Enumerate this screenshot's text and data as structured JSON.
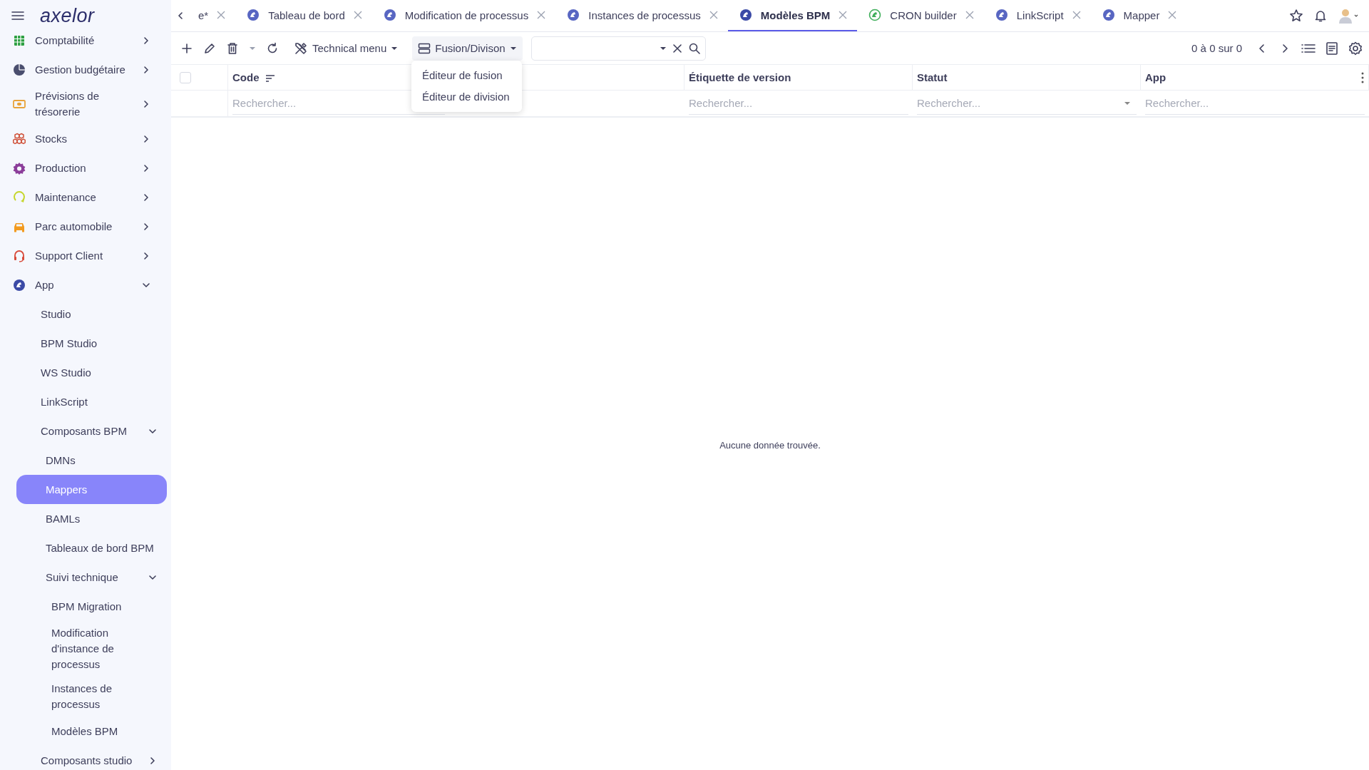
{
  "app": {
    "logo": "axelor"
  },
  "sidebar": {
    "items": [
      {
        "label": "Comptabilité",
        "color": "#2ea043",
        "expanded": false
      },
      {
        "label": "Gestion budgétaire",
        "color": "#4a4e6e",
        "expanded": false
      },
      {
        "label": "Prévisions de trésorerie",
        "color": "#e8a33a",
        "expanded": false
      },
      {
        "label": "Stocks",
        "color": "#d0523a",
        "expanded": false
      },
      {
        "label": "Production",
        "color": "#8b3d9a",
        "expanded": false
      },
      {
        "label": "Maintenance",
        "color": "#c5d62a",
        "expanded": false
      },
      {
        "label": "Parc automobile",
        "color": "#f29a1f",
        "expanded": false
      },
      {
        "label": "Support Client",
        "color": "#d84a3a",
        "expanded": false
      },
      {
        "label": "App",
        "color": "#3b4aa6",
        "expanded": true,
        "children": [
          {
            "label": "Studio",
            "selected": false
          },
          {
            "label": "BPM Studio",
            "selected": false
          },
          {
            "label": "WS Studio",
            "selected": false
          },
          {
            "label": "LinkScript",
            "selected": false
          },
          {
            "label": "Composants BPM",
            "expanded": true,
            "children": [
              {
                "label": "DMNs",
                "selected": false
              },
              {
                "label": "Mappers",
                "selected": true
              },
              {
                "label": "BAMLs",
                "selected": false
              },
              {
                "label": "Tableaux de bord BPM",
                "selected": false
              },
              {
                "label": "Suivi technique",
                "expanded": true,
                "children": [
                  {
                    "label": "BPM Migration",
                    "selected": false
                  },
                  {
                    "label": "Modification d'instance de processus",
                    "selected": false
                  },
                  {
                    "label": "Instances de processus",
                    "selected": false
                  },
                  {
                    "label": "Modèles BPM",
                    "selected": false
                  }
                ]
              }
            ]
          },
          {
            "label": "Composants studio",
            "expanded": false
          }
        ]
      }
    ]
  },
  "tabs": [
    {
      "label": "e*",
      "selected": false,
      "kind": "plain"
    },
    {
      "label": "Tableau de bord",
      "selected": false,
      "kind": "bpm"
    },
    {
      "label": "Modification de processus",
      "selected": false,
      "kind": "bpm"
    },
    {
      "label": "Instances de processus",
      "selected": false,
      "kind": "bpm"
    },
    {
      "label": "Modèles BPM",
      "selected": true,
      "kind": "bpm"
    },
    {
      "label": "CRON builder",
      "selected": false,
      "kind": "cron"
    },
    {
      "label": "LinkScript",
      "selected": false,
      "kind": "bpm"
    },
    {
      "label": "Mapper",
      "selected": false,
      "kind": "bpm"
    }
  ],
  "toolbar": {
    "technical_menu": "Technical menu",
    "fusion_button": "Fusion/Divison",
    "pager": "0 à 0 sur 0"
  },
  "dropdown": {
    "items": [
      "Éditeur de fusion",
      "Éditeur de division"
    ]
  },
  "table": {
    "select_all": {
      "checked": false
    },
    "columns": [
      {
        "label": "Code",
        "filter": "Rechercher..."
      },
      {
        "label": "Étiquette de version",
        "filter": "Rechercher..."
      },
      {
        "label": "Statut",
        "filter": "Rechercher..."
      },
      {
        "label": "App",
        "filter": "Rechercher..."
      }
    ],
    "empty_message": "Aucune donnée trouvée."
  }
}
